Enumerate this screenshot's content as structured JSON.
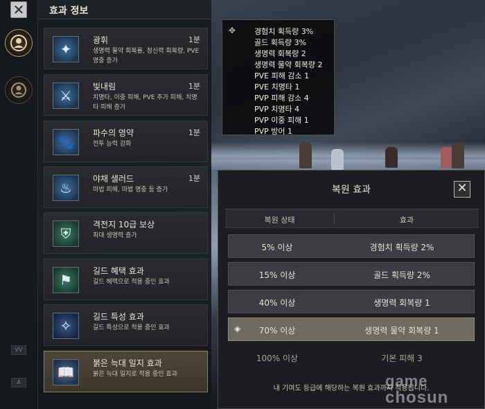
{
  "panel": {
    "title": "효과 정보",
    "cards": [
      {
        "title": "광휘",
        "time": "1분",
        "desc": "생명력 물약 회복률, 정신력 회복량, PVE 명중 증가",
        "icon": "compass-star-icon",
        "color": "blue"
      },
      {
        "title": "빛내림",
        "time": "1분",
        "desc": "치명타, 이중 피해, PVE 추가 피해, 치명타 피해 증가",
        "icon": "sword-trident-icon",
        "color": "blue"
      },
      {
        "title": "파수의 영약",
        "time": "1분",
        "desc": "전투 능력 강화",
        "icon": "paw-icon",
        "color": "blue"
      },
      {
        "title": "야채 샐러드",
        "time": "1분",
        "desc": "마법 피해, 마법 명중 등 증가",
        "icon": "food-dome-icon",
        "color": "blue"
      },
      {
        "title": "격전지 10급 보상",
        "time": "",
        "desc": "최대 생명력 증가",
        "icon": "shield-emblem-icon",
        "color": "green"
      },
      {
        "title": "길드 혜택 효과",
        "time": "",
        "desc": "길드 혜택으로 적용 중인 효과",
        "icon": "guild-banner-icon",
        "color": "green"
      },
      {
        "title": "길드 특성 효과",
        "time": "",
        "desc": "길드 특성으로 적용 중인 효과",
        "icon": "constellation-icon",
        "color": "navy"
      },
      {
        "title": "붉은 늑대 일지 효과",
        "time": "",
        "desc": "붉은 늑대 일지로 적용 중인 효과",
        "icon": "open-book-icon",
        "color": "paper"
      }
    ]
  },
  "tooltip": {
    "lines": [
      "경험치 획득량 3%",
      "골드 획득량 3%",
      "생명력 회복량 2",
      "생명력 물약 회복량 2",
      "PVE 피해 감소 1",
      "PVE 치명타 1",
      "PVP 피해 감소 4",
      "PVP 치명타 4",
      "PVP 이중 피해 1",
      "PVP 방어 1"
    ]
  },
  "dialog": {
    "title": "복원 효과",
    "close": "✕",
    "col_status": "복원 상태",
    "col_effect": "효과",
    "rows": [
      {
        "status": "5% 이상",
        "effect": "경험치 획득량 2%",
        "state": "normal"
      },
      {
        "status": "15% 이상",
        "effect": "골드 획득량 2%",
        "state": "normal"
      },
      {
        "status": "40% 이상",
        "effect": "생명력 회복량 1",
        "state": "normal"
      },
      {
        "status": "70% 이상",
        "effect": "생명력 물약 회복량 1",
        "state": "current"
      },
      {
        "status": "100% 이상",
        "effect": "기본 피해 3",
        "state": "locked"
      }
    ],
    "footnote": "내 기여도 등급에 해당하는 복원 효과까지 적용됩니다."
  },
  "rail": {
    "close": "✕",
    "small_1": "VV",
    "small_2": "A"
  },
  "watermark": {
    "line1": "game",
    "line2": "chosun"
  }
}
